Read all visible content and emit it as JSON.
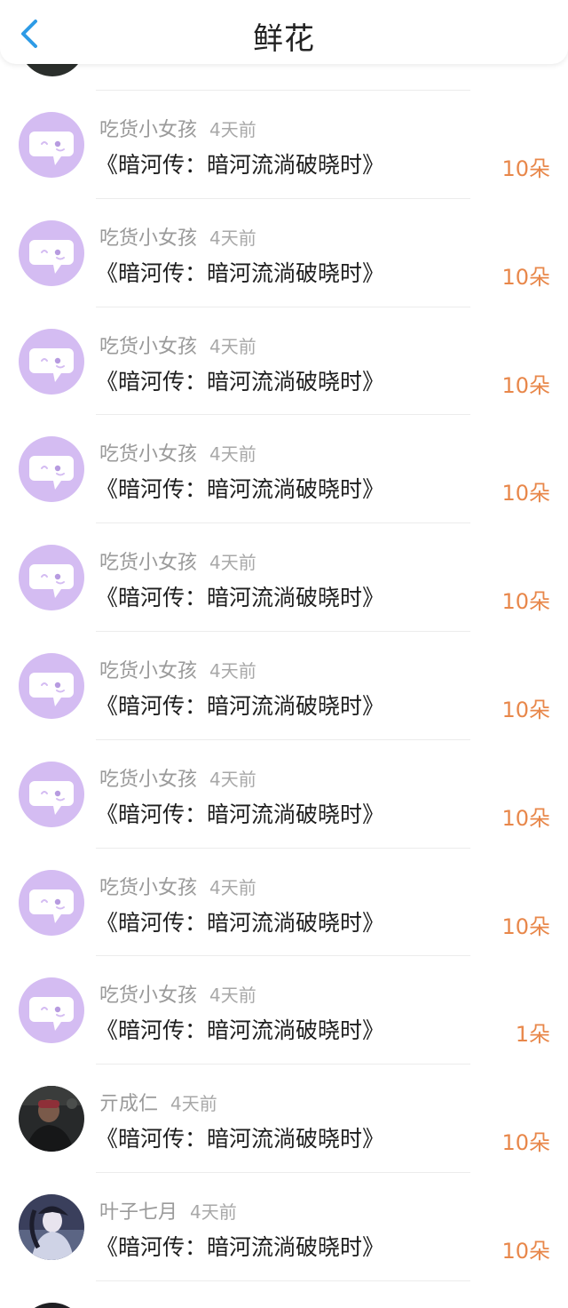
{
  "header": {
    "title": "鲜花",
    "back_icon": "chevron-left-icon"
  },
  "items": [
    {
      "avatar": "speech-bubble",
      "name": "吃货小女孩",
      "time": "4天前",
      "book": "《暗河传：暗河流淌破晓时》",
      "count": "10朵"
    },
    {
      "avatar": "speech-bubble",
      "name": "吃货小女孩",
      "time": "4天前",
      "book": "《暗河传：暗河流淌破晓时》",
      "count": "10朵"
    },
    {
      "avatar": "speech-bubble",
      "name": "吃货小女孩",
      "time": "4天前",
      "book": "《暗河传：暗河流淌破晓时》",
      "count": "10朵"
    },
    {
      "avatar": "speech-bubble",
      "name": "吃货小女孩",
      "time": "4天前",
      "book": "《暗河传：暗河流淌破晓时》",
      "count": "10朵"
    },
    {
      "avatar": "speech-bubble",
      "name": "吃货小女孩",
      "time": "4天前",
      "book": "《暗河传：暗河流淌破晓时》",
      "count": "10朵"
    },
    {
      "avatar": "speech-bubble",
      "name": "吃货小女孩",
      "time": "4天前",
      "book": "《暗河传：暗河流淌破晓时》",
      "count": "10朵"
    },
    {
      "avatar": "speech-bubble",
      "name": "吃货小女孩",
      "time": "4天前",
      "book": "《暗河传：暗河流淌破晓时》",
      "count": "10朵"
    },
    {
      "avatar": "speech-bubble",
      "name": "吃货小女孩",
      "time": "4天前",
      "book": "《暗河传：暗河流淌破晓时》",
      "count": "10朵"
    },
    {
      "avatar": "speech-bubble",
      "name": "吃货小女孩",
      "time": "4天前",
      "book": "《暗河传：暗河流淌破晓时》",
      "count": "1朵"
    },
    {
      "avatar": "photo-person-dark",
      "name": "亓成仁",
      "time": "4天前",
      "book": "《暗河传：暗河流淌破晓时》",
      "count": "10朵"
    },
    {
      "avatar": "photo-illustration",
      "name": "叶子七月",
      "time": "4天前",
      "book": "《暗河传：暗河流淌破晓时》",
      "count": "10朵"
    }
  ],
  "colors": {
    "accent_back": "#2e9be6",
    "count": "#e8874a",
    "avatar_purple": "#d4bcf2"
  }
}
